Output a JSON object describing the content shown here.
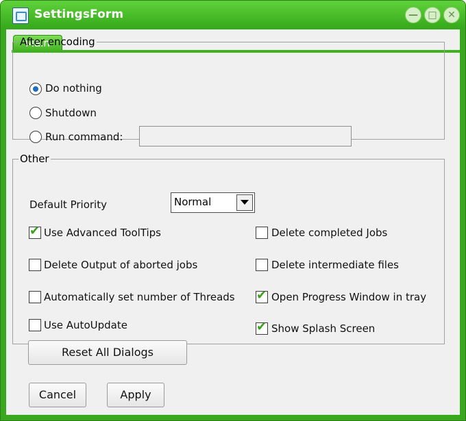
{
  "window": {
    "title": "SettingsForm",
    "controls": {
      "minimize": "—",
      "maximize": "□",
      "close": "✕"
    }
  },
  "tabs": [
    {
      "label": "Main",
      "selected": true
    }
  ],
  "after_encoding": {
    "legend": "After encoding",
    "options": [
      {
        "label": "Do nothing",
        "checked": true
      },
      {
        "label": "Shutdown",
        "checked": false
      },
      {
        "label": "Run command:",
        "checked": false
      }
    ],
    "command_value": ""
  },
  "other": {
    "legend": "Other",
    "default_priority_label": "Default Priority",
    "priority_value": "Normal",
    "checkboxes": [
      {
        "label": "Use Advanced ToolTips",
        "checked": true
      },
      {
        "label": "Delete completed Jobs",
        "checked": false
      },
      {
        "label": "Delete Output of aborted jobs",
        "checked": false
      },
      {
        "label": "Delete intermediate files",
        "checked": false
      },
      {
        "label": "Automatically set number of Threads",
        "checked": false
      },
      {
        "label": "Open Progress Window in tray",
        "checked": true
      },
      {
        "label": "Use AutoUpdate",
        "checked": false
      },
      {
        "label": "Show Splash Screen",
        "checked": true
      }
    ],
    "reset_button": "Reset All Dialogs"
  },
  "buttons": {
    "cancel": "Cancel",
    "apply": "Apply"
  },
  "colors": {
    "titlebar": "#3aa81f",
    "accent_check": "#39a21a"
  }
}
